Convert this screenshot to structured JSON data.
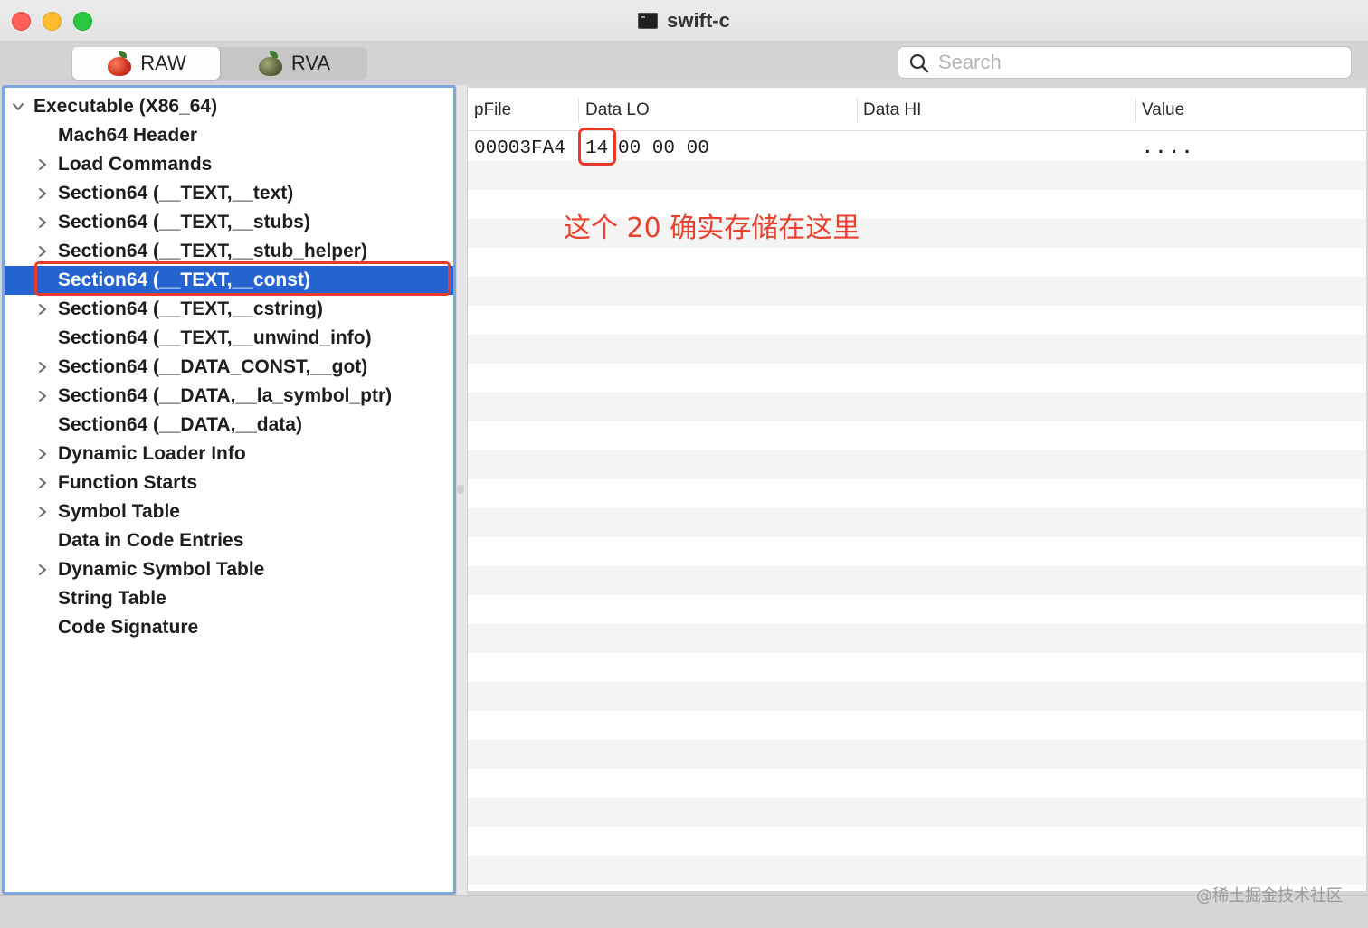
{
  "window": {
    "title": "swift-c"
  },
  "toolbar": {
    "segments": [
      {
        "label": "RAW",
        "active": true
      },
      {
        "label": "RVA",
        "active": false
      }
    ],
    "search": {
      "placeholder": "Search",
      "value": ""
    }
  },
  "tree": {
    "items": [
      {
        "label": "Executable  (X86_64)",
        "level": 0,
        "expander": "expanded"
      },
      {
        "label": "Mach64 Header",
        "level": 1,
        "expander": "none"
      },
      {
        "label": "Load Commands",
        "level": 1,
        "expander": "collapsed"
      },
      {
        "label": "Section64 (__TEXT,__text)",
        "level": 1,
        "expander": "collapsed"
      },
      {
        "label": "Section64 (__TEXT,__stubs)",
        "level": 1,
        "expander": "collapsed"
      },
      {
        "label": "Section64 (__TEXT,__stub_helper)",
        "level": 1,
        "expander": "collapsed"
      },
      {
        "label": "Section64 (__TEXT,__const)",
        "level": 1,
        "expander": "none",
        "selected": true
      },
      {
        "label": "Section64 (__TEXT,__cstring)",
        "level": 1,
        "expander": "collapsed"
      },
      {
        "label": "Section64 (__TEXT,__unwind_info)",
        "level": 1,
        "expander": "none"
      },
      {
        "label": "Section64 (__DATA_CONST,__got)",
        "level": 1,
        "expander": "collapsed"
      },
      {
        "label": "Section64 (__DATA,__la_symbol_ptr)",
        "level": 1,
        "expander": "collapsed"
      },
      {
        "label": "Section64 (__DATA,__data)",
        "level": 1,
        "expander": "none"
      },
      {
        "label": "Dynamic Loader Info",
        "level": 1,
        "expander": "collapsed"
      },
      {
        "label": "Function Starts",
        "level": 1,
        "expander": "collapsed"
      },
      {
        "label": "Symbol Table",
        "level": 1,
        "expander": "collapsed"
      },
      {
        "label": "Data in Code Entries",
        "level": 1,
        "expander": "none"
      },
      {
        "label": "Dynamic Symbol Table",
        "level": 1,
        "expander": "collapsed"
      },
      {
        "label": "String Table",
        "level": 1,
        "expander": "none"
      },
      {
        "label": "Code Signature",
        "level": 1,
        "expander": "none"
      }
    ]
  },
  "table": {
    "columns": [
      "pFile",
      "Data LO",
      "Data HI",
      "Value"
    ],
    "rows": [
      {
        "pfile": "00003FA4",
        "data_lo_first": "14",
        "data_lo_rest": "00 00 00",
        "data_hi": "",
        "value": "...."
      }
    ]
  },
  "annotation": {
    "text": "这个 20 确实存储在这里"
  },
  "watermark": {
    "text": "@稀土掘金技术社区"
  },
  "colors": {
    "selection": "#2463d0",
    "highlight_box": "#e53a2c",
    "annotation": "#e8412d",
    "panel_border": "#7ea6e0"
  }
}
